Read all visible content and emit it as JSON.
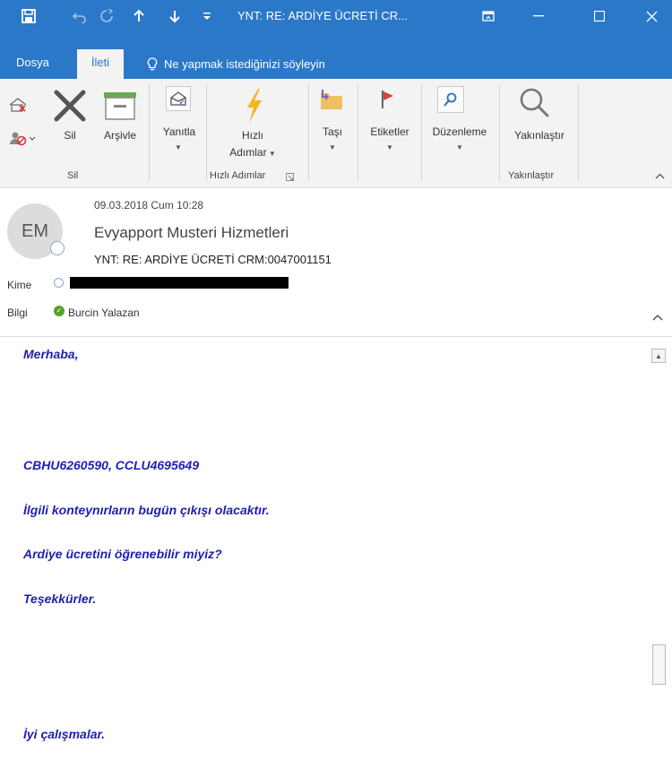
{
  "window": {
    "title": "YNT: RE: ARDİYE ÜCRETİ  CR...",
    "save_icon": "save-icon",
    "colors": {
      "titlebar": "#2b78c8",
      "ribbon": "#f3f3f3",
      "body_text": "#1f1fb4"
    }
  },
  "tabs": [
    {
      "label": "Dosya"
    },
    {
      "label": "İleti",
      "active": true
    }
  ],
  "tell_me": "Ne yapmak istediğinizi söyleyin",
  "ribbon": {
    "delete": {
      "sil": "Sil",
      "arsivle": "Arşivle",
      "group": "Sil"
    },
    "respond": {
      "yanitla": "Yanıtla"
    },
    "quicksteps": {
      "label1": "Hızlı",
      "label2": "Adımlar",
      "group": "Hızlı Adımlar"
    },
    "move": {
      "label": "Taşı"
    },
    "tags": {
      "label": "Etiketler"
    },
    "editing": {
      "label": "Düzenleme"
    },
    "zoom": {
      "label": "Yakınlaştır",
      "group": "Yakınlaştır"
    }
  },
  "header": {
    "avatar_initials": "EM",
    "date": "09.03.2018 Cum 10:28",
    "sender": "Evyapport Musteri Hizmetleri",
    "subject": "YNT: RE: ARDİYE ÜCRETİ  CRM:0047001151",
    "to_label": "Kime",
    "cc_label": "Bilgi",
    "cc_name": "Burcin Yalazan"
  },
  "body": {
    "greeting": "Merhaba,",
    "containers": "CBHU6260590, CCLU4695649",
    "line1": "İlgili konteynırların bugün çıkışı olacaktır.",
    "line2": "Ardiye ücretini öğrenebilir miyiz?",
    "thanks": "Teşekkürler.",
    "closing": "İyi çalışmalar."
  }
}
